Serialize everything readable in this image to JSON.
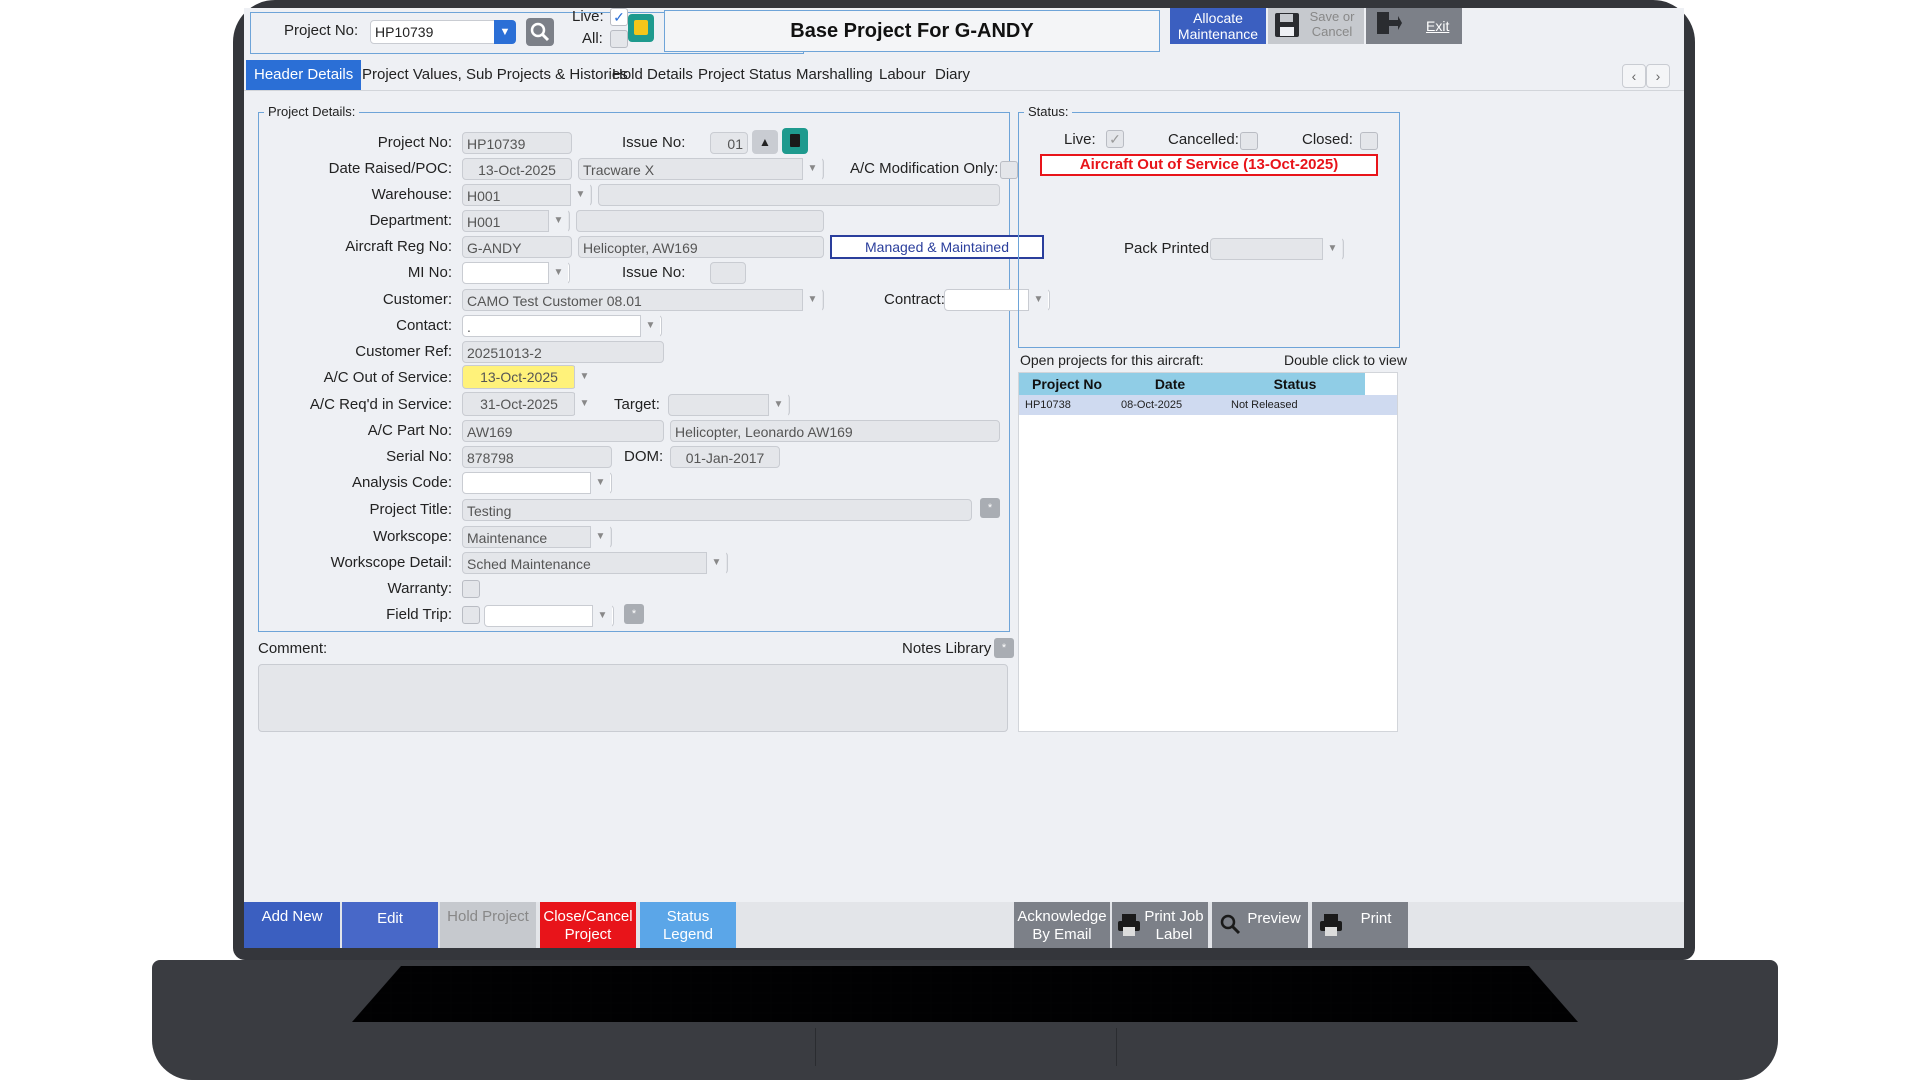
{
  "toolbar": {
    "project_no_label": "Project No:",
    "project_no_value": "HP10739",
    "live_label": "Live:",
    "all_label": "All:",
    "title": "Base Project For G-ANDY",
    "allocate_maintenance": "Allocate Maintenance",
    "save_or_cancel": "Save or Cancel",
    "exit": "Exit"
  },
  "tabs": [
    {
      "label": "Header Details"
    },
    {
      "label": "Project Values, Sub Projects & Histories"
    },
    {
      "label": "Hold Details"
    },
    {
      "label": "Project Status"
    },
    {
      "label": "Marshalling"
    },
    {
      "label": "Labour"
    },
    {
      "label": "Diary"
    }
  ],
  "project_details": {
    "group_title": "Project Details:",
    "project_no_label": "Project No:",
    "project_no": "HP10739",
    "issue_no_label": "Issue No:",
    "issue_no": "01",
    "date_raised_label": "Date Raised/POC:",
    "date_raised": "13-Oct-2025",
    "poc": "Tracware X",
    "ac_mod_label": "A/C Modification Only:",
    "warehouse_label": "Warehouse:",
    "warehouse": "H001",
    "department_label": "Department:",
    "department": "H001",
    "aircraft_reg_label": "Aircraft Reg No:",
    "aircraft_reg": "G-ANDY",
    "aircraft_type": "Helicopter, AW169",
    "managed_badge": "Managed & Maintained",
    "mi_no_label": "MI No:",
    "mi_issue_label": "Issue No:",
    "customer_label": "Customer:",
    "customer": "CAMO Test Customer 08.01",
    "contract_label": "Contract:",
    "contact_label": "Contact:",
    "contact": ".",
    "customer_ref_label": "Customer Ref:",
    "customer_ref": "20251013-2",
    "ac_out_label": "A/C Out of Service:",
    "ac_out": "13-Oct-2025",
    "ac_reqd_label": "A/C Req'd in Service:",
    "ac_reqd": "31-Oct-2025",
    "target_label": "Target:",
    "ac_part_label": "A/C Part No:",
    "ac_part": "AW169",
    "ac_part_desc": "Helicopter, Leonardo AW169",
    "serial_label": "Serial No:",
    "serial": "878798",
    "dom_label": "DOM:",
    "dom": "01-Jan-2017",
    "analysis_label": "Analysis Code:",
    "project_title_label": "Project Title:",
    "project_title": "Testing",
    "workscope_label": "Workscope:",
    "workscope": "Maintenance",
    "workscope_detail_label": "Workscope Detail:",
    "workscope_detail": "Sched Maintenance",
    "warranty_label": "Warranty:",
    "field_trip_label": "Field Trip:"
  },
  "comment": {
    "label": "Comment:",
    "notes_library": "Notes Library"
  },
  "status": {
    "group_title": "Status:",
    "live_label": "Live:",
    "cancelled_label": "Cancelled:",
    "closed_label": "Closed:",
    "alert": "Aircraft Out of Service (13-Oct-2025)",
    "pack_printed_label": "Pack Printed:"
  },
  "open_projects": {
    "heading": "Open projects for this aircraft:",
    "hint": "Double click to view",
    "columns": [
      "Project No",
      "Date",
      "Status"
    ],
    "rows": [
      {
        "project_no": "HP10738",
        "date": "08-Oct-2025",
        "status": "Not Released"
      }
    ]
  },
  "bottom": {
    "add_new": "Add New",
    "edit": "Edit",
    "hold_project": "Hold Project",
    "close_cancel": "Close/Cancel Project",
    "status_legend": "Status Legend",
    "acknowledge": "Acknowledge By Email",
    "print_job_label": "Print Job Label",
    "preview": "Preview",
    "print": "Print"
  },
  "colors": {
    "accent": "#2b6fd6",
    "danger": "#e8141a",
    "badge_border": "#2a3e9c",
    "highlight": "#fff27a"
  }
}
